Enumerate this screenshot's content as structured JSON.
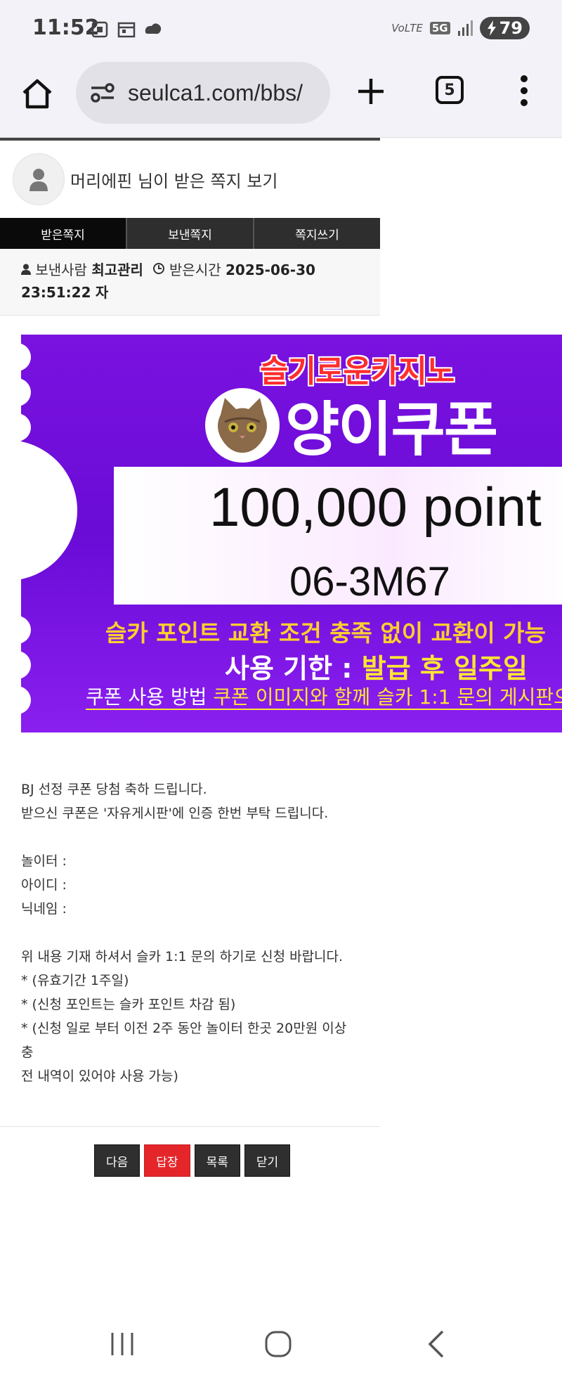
{
  "status": {
    "time": "11:52",
    "volte": "VoLTE",
    "net": "5G",
    "battery": "79",
    "icons": [
      "screenshot-icon",
      "calendar-icon",
      "cloud-icon",
      "signal-icon",
      "battery-charging-icon"
    ]
  },
  "browser": {
    "url": "seulca1.com/bbs/",
    "tab_count": "5",
    "icons": [
      "home-icon",
      "site-settings-icon",
      "new-tab-icon",
      "tabs-icon",
      "more-menu-icon"
    ]
  },
  "memo": {
    "title": "머리에핀 님이 받은 쪽지 보기",
    "tabs": [
      {
        "label": "받은쪽지",
        "active": true
      },
      {
        "label": "보낸쪽지",
        "active": false
      },
      {
        "label": "쪽지쓰기",
        "active": false
      }
    ],
    "sender_label": "보낸사람",
    "sender": "최고관리",
    "time_label": "받은시간",
    "time": "2025-06-30 23:51:22",
    "suffix": "자"
  },
  "banner": {
    "casino": "슬기로운카지노",
    "coupon_name": "양이쿠폰",
    "points": "100,000 point",
    "code": "06-3M67",
    "condition": "슬카 포인트 교환 조건 충족 없이 교환이 가능",
    "expiry_label": "사용 기한 :",
    "expiry_value": "발급 후 일주일",
    "howto_label": "쿠폰 사용 방법",
    "howto_text": "쿠폰 이미지와 함께 슬카 1:1 문의 게시판으",
    "colors": {
      "purple": "#7a12e0",
      "red": "#ff2d2d",
      "yellow": "#ffe633"
    }
  },
  "message": {
    "lines": [
      "BJ 선정 쿠폰 당첨 축하 드립니다.",
      "받으신 쿠폰은 '자유게시판'에 인증 한번 부탁 드립니다.",
      "",
      "놀이터 :",
      "아이디 :",
      "닉네임 :",
      "",
      "위 내용 기재 하셔서 슬카 1:1 문의 하기로 신청 바랍니다.",
      "* (유효기간 1주일)",
      "* (신청 포인트는 슬카 포인트 차감 됨)",
      "* (신청 일로 부터 이전 2주 동안 놀이터 한곳 20만원 이상 충",
      "전 내역이 있어야 사용 가능)"
    ]
  },
  "buttons": {
    "next": "다음",
    "reply": "답장",
    "list": "목록",
    "close": "닫기"
  },
  "navbar": {
    "icons": [
      "recent-apps-icon",
      "home-nav-icon",
      "back-icon"
    ]
  }
}
